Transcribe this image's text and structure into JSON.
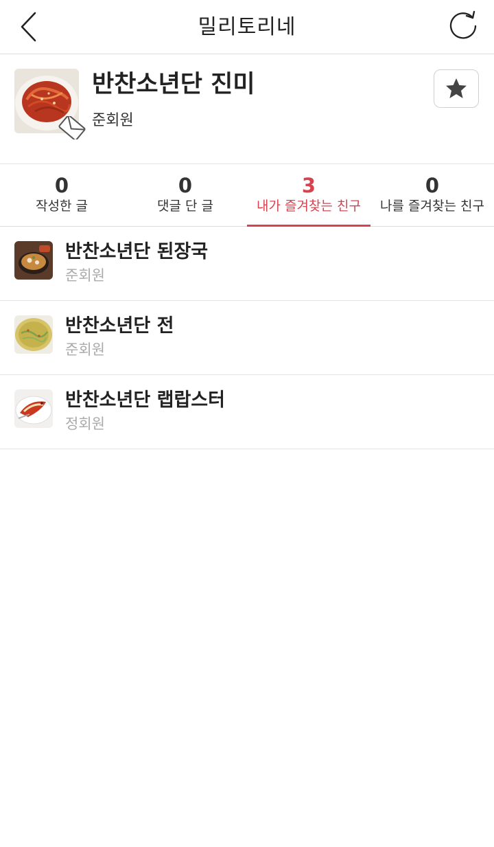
{
  "header": {
    "title": "밀리토리네",
    "back_icon": "chevron-left-icon",
    "refresh_icon": "refresh-icon"
  },
  "profile": {
    "name": "반찬소년단 진미",
    "grade": "준회원",
    "favorite_icon": "star-icon",
    "message_icon": "envelope-icon"
  },
  "tabs": [
    {
      "count": "0",
      "label": "작성한 글",
      "active": false
    },
    {
      "count": "0",
      "label": "댓글 단 글",
      "active": false
    },
    {
      "count": "3",
      "label": "내가 즐겨찾는 친구",
      "active": true
    },
    {
      "count": "0",
      "label": "나를 즐겨찾는 친구",
      "active": false
    }
  ],
  "friends": [
    {
      "name": "반찬소년단 된장국",
      "grade": "준회원"
    },
    {
      "name": "반찬소년단 전",
      "grade": "준회원"
    },
    {
      "name": "반찬소년단 랩랍스터",
      "grade": "정회원"
    }
  ],
  "colors": {
    "accent": "#d6434f",
    "text": "#222222",
    "muted": "#aaaaaa",
    "divider": "#e3e3e3"
  }
}
